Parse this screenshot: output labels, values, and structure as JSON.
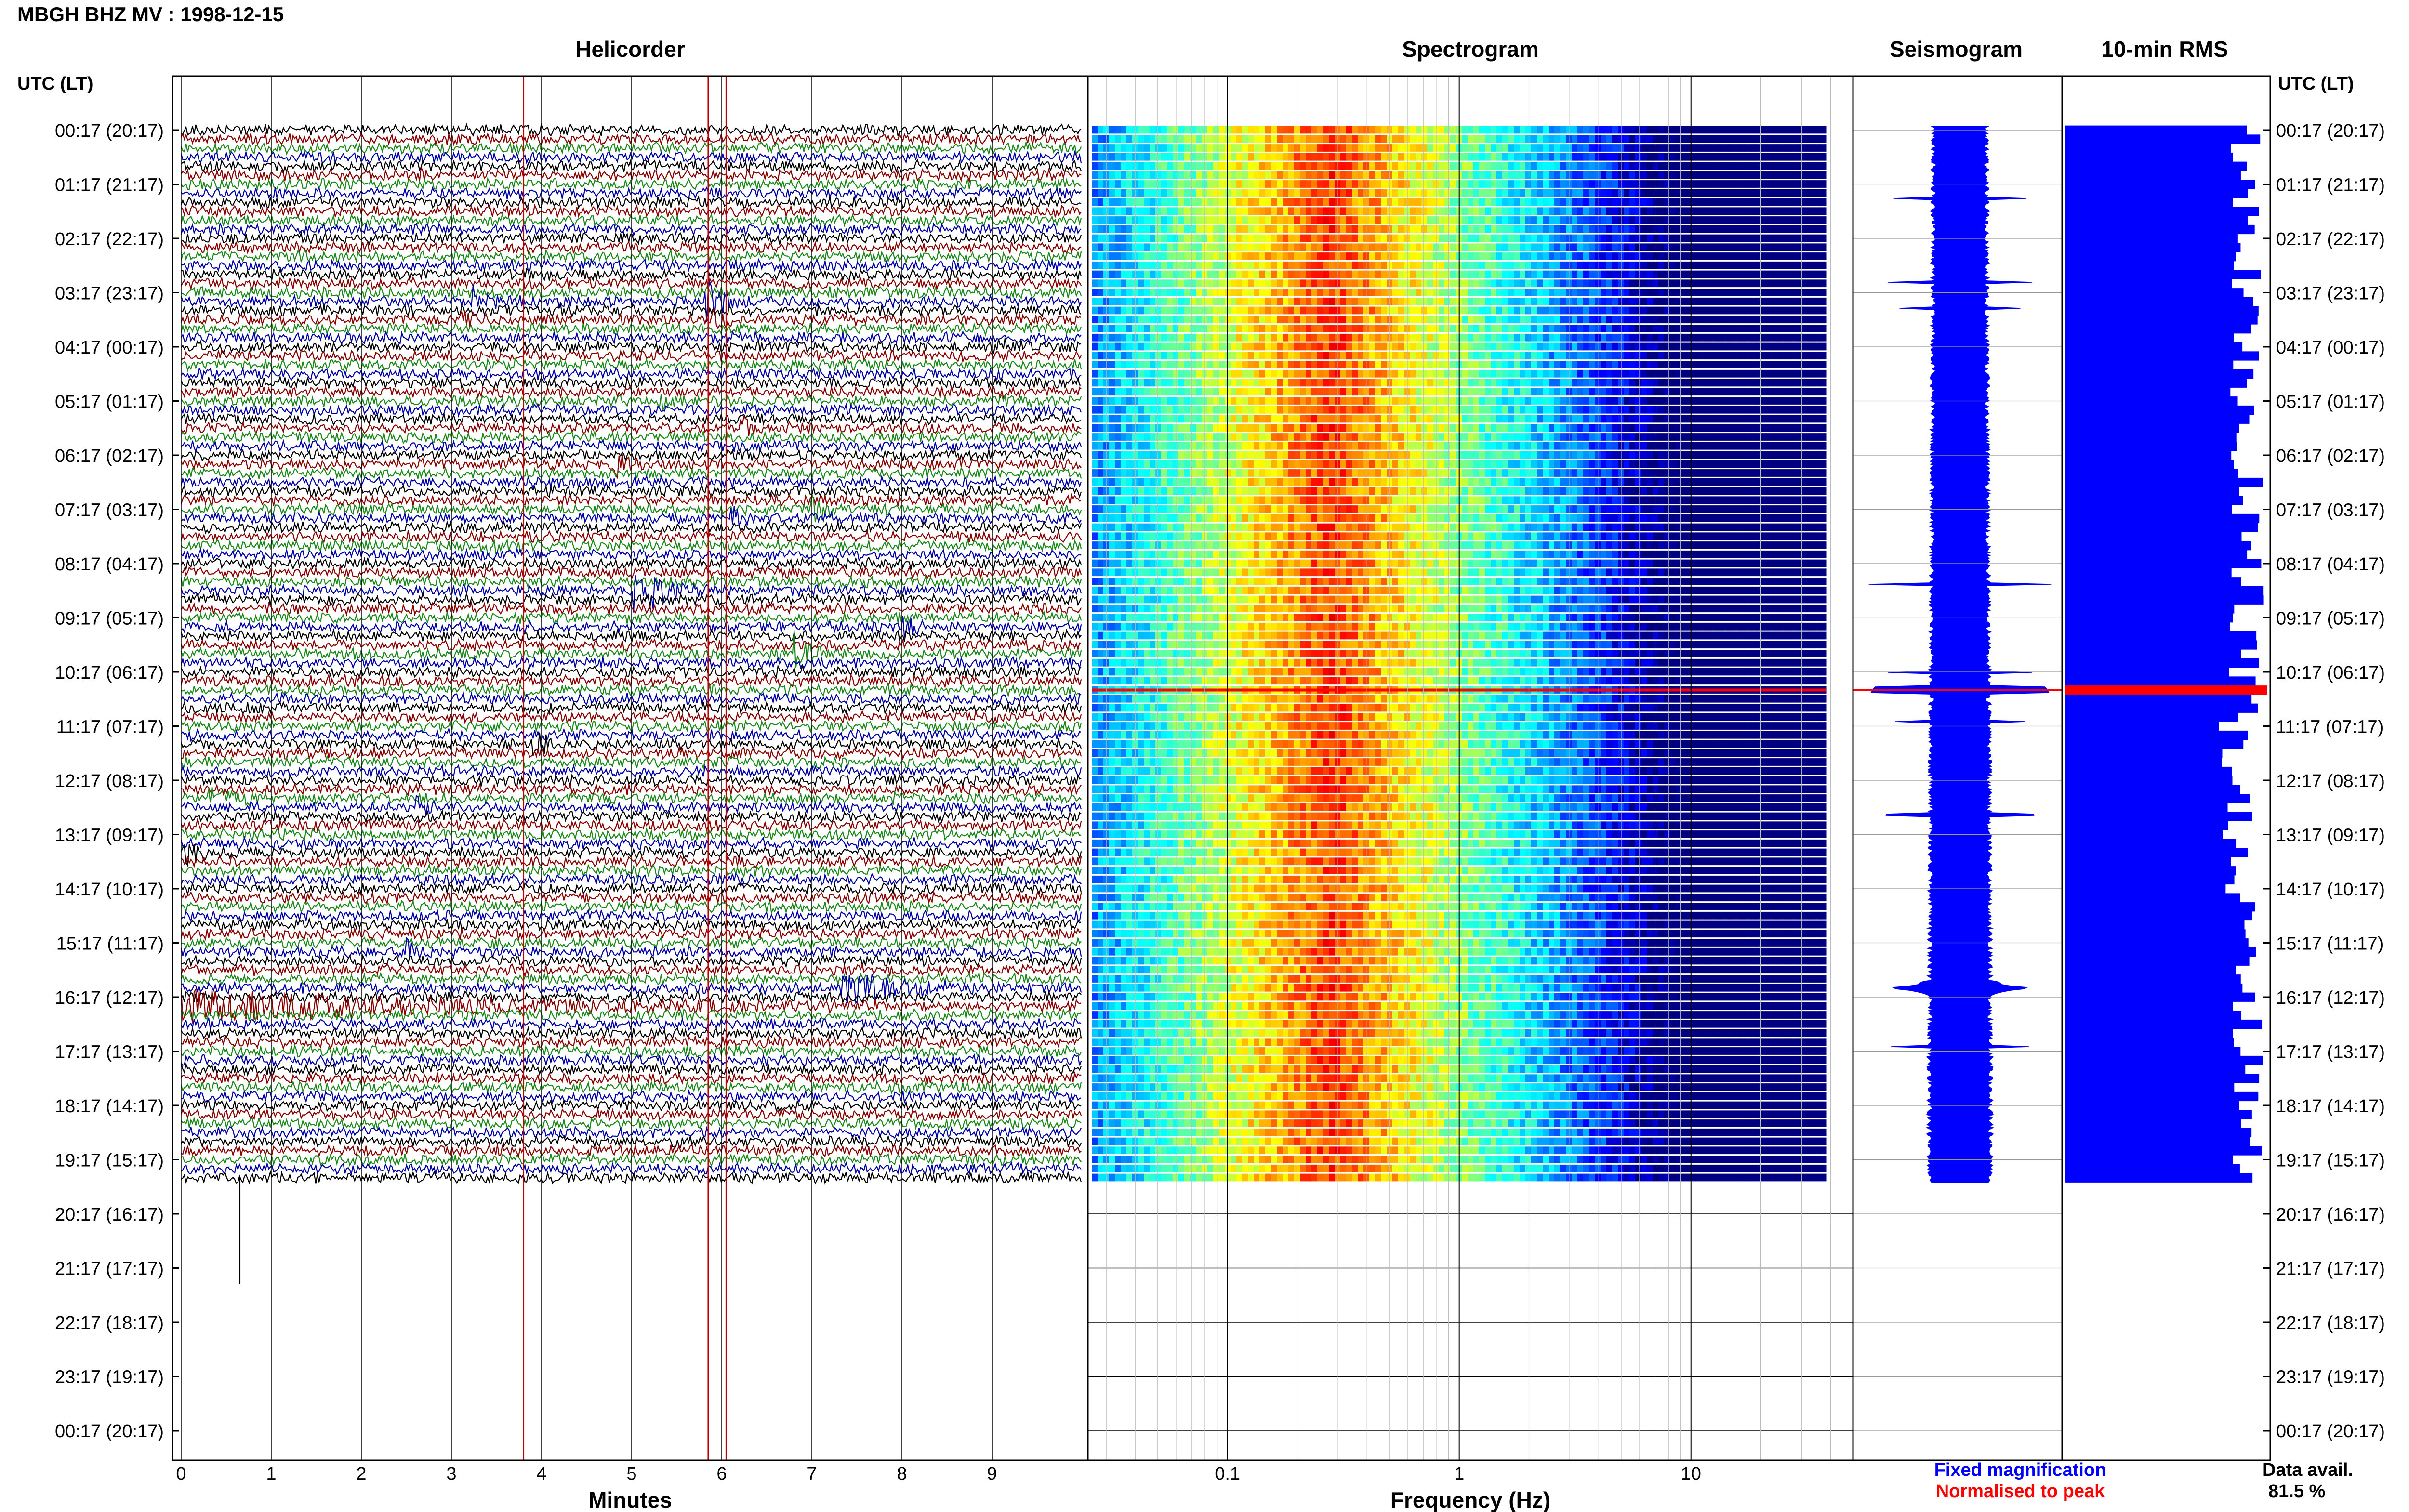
{
  "title": "MBGH BHZ MV : 1998-12-15",
  "panels": {
    "helicorder": "Helicorder",
    "spectrogram": "Spectrogram",
    "seismogram": "Seismogram",
    "rms": "10-min RMS"
  },
  "time_axis_header": "UTC (LT)",
  "footer": {
    "fixed_magnification": "Fixed magnification",
    "normalised_to_peak": "Normalised to peak",
    "data_avail_label": "Data avail.",
    "data_avail_value": "81.5 %"
  },
  "colors": {
    "trace": [
      "#000000",
      "#8b0000",
      "#1a8a1a",
      "#0000aa"
    ],
    "blue_fill": "#0000ff",
    "red_highlight": "#ff0000",
    "grid": "#000000"
  },
  "chart_data": [
    {
      "type": "line",
      "name": "helicorder",
      "title": "Helicorder",
      "xlabel": "Minutes",
      "ylabel": "UTC (LT)",
      "x_ticks": [
        "0",
        "1",
        "2",
        "3",
        "4",
        "5",
        "6",
        "7",
        "8",
        "9"
      ],
      "xlim": [
        0,
        10
      ],
      "y_ticks": [
        "00:17 (20:17)",
        "01:17 (21:17)",
        "02:17 (22:17)",
        "03:17 (23:17)",
        "04:17 (00:17)",
        "05:17 (01:17)",
        "06:17 (02:17)",
        "07:17 (03:17)",
        "08:17 (04:17)",
        "09:17 (05:17)",
        "10:17 (06:17)",
        "11:17 (07:17)",
        "12:17 (08:17)",
        "13:17 (09:17)",
        "14:17 (10:17)",
        "15:17 (11:17)",
        "16:17 (12:17)",
        "17:17 (13:17)",
        "18:17 (14:17)",
        "19:17 (15:17)",
        "20:17 (16:17)",
        "21:17 (17:17)",
        "22:17 (18:17)",
        "23:17 (19:17)",
        "00:17 (20:17)"
      ],
      "rows_per_hour": 6,
      "data_rows": 117,
      "red_marker_minutes": [
        3.8,
        5.85,
        6.05
      ],
      "events": [
        {
          "row": 5,
          "minute": 2.6,
          "amp": 1.0,
          "len": 0.2
        },
        {
          "row": 19,
          "minute": 3.2,
          "amp": 2.4,
          "len": 0.6
        },
        {
          "row": 21,
          "minute": 3.1,
          "amp": 1.2,
          "len": 0.3
        },
        {
          "row": 19,
          "minute": 5.8,
          "amp": 3.8,
          "len": 0.5
        },
        {
          "row": 21,
          "minute": 5.9,
          "amp": 2.2,
          "len": 0.3
        },
        {
          "row": 24,
          "minute": 9.0,
          "amp": 1.0,
          "len": 0.4
        },
        {
          "row": 30,
          "minute": 5.3,
          "amp": 1.0,
          "len": 0.3
        },
        {
          "row": 33,
          "minute": 6.2,
          "amp": 1.3,
          "len": 0.4
        },
        {
          "row": 37,
          "minute": 4.8,
          "amp": 1.6,
          "len": 0.4
        },
        {
          "row": 42,
          "minute": 7.0,
          "amp": 1.8,
          "len": 0.4
        },
        {
          "row": 43,
          "minute": 6.1,
          "amp": 1.3,
          "len": 0.4
        },
        {
          "row": 46,
          "minute": 3.4,
          "amp": 1.3,
          "len": 0.4
        },
        {
          "row": 51,
          "minute": 5.0,
          "amp": 4.2,
          "len": 0.9
        },
        {
          "row": 55,
          "minute": 8.0,
          "amp": 1.5,
          "len": 0.4
        },
        {
          "row": 58,
          "minute": 6.8,
          "amp": 3.2,
          "len": 0.4
        },
        {
          "row": 68,
          "minute": 3.9,
          "amp": 1.8,
          "len": 0.5
        },
        {
          "row": 74,
          "minute": 0.3,
          "amp": 1.5,
          "len": 0.6
        },
        {
          "row": 75,
          "minute": 2.6,
          "amp": 1.0,
          "len": 0.4
        },
        {
          "row": 74,
          "minute": 7.9,
          "amp": 1.0,
          "len": 0.2
        },
        {
          "row": 80,
          "minute": 0.0,
          "amp": 2.2,
          "len": 0.4
        },
        {
          "row": 91,
          "minute": 2.5,
          "amp": 2.6,
          "len": 0.3
        },
        {
          "row": 95,
          "minute": 7.3,
          "amp": 2.8,
          "len": 1.5
        },
        {
          "row": 97,
          "minute": 0.0,
          "amp": 2.0,
          "len": 8.0
        }
      ]
    },
    {
      "type": "heatmap",
      "name": "spectrogram",
      "title": "Spectrogram",
      "xlabel": "Frequency (Hz)",
      "x_scale": "log",
      "xlim": [
        0.025,
        50
      ],
      "x_ticks": [
        "0.1",
        "1",
        "10"
      ],
      "x_tick_values": [
        0.1,
        1,
        10
      ],
      "rows": 117,
      "peak_frequency_range_hz": [
        0.15,
        0.55
      ],
      "colormap": "jet"
    },
    {
      "type": "area",
      "name": "seismogram",
      "title": "Seismogram",
      "rows": 117
    },
    {
      "type": "bar",
      "name": "rms",
      "title": "10-min RMS",
      "orientation": "horizontal",
      "rows": 117,
      "red_highlight_row": 62
    }
  ]
}
